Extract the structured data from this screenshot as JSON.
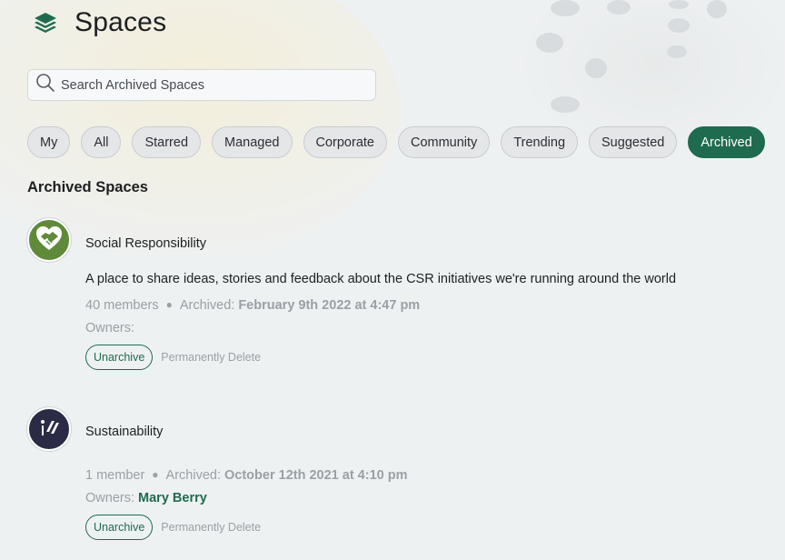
{
  "header": {
    "title": "Spaces",
    "icon": "layers-icon",
    "accent": "#1f6b4f"
  },
  "search": {
    "placeholder": "Search Archived Spaces",
    "value": ""
  },
  "filters": [
    {
      "label": "My",
      "active": false
    },
    {
      "label": "All",
      "active": false
    },
    {
      "label": "Starred",
      "active": false
    },
    {
      "label": "Managed",
      "active": false
    },
    {
      "label": "Corporate",
      "active": false
    },
    {
      "label": "Community",
      "active": false
    },
    {
      "label": "Trending",
      "active": false
    },
    {
      "label": "Suggested",
      "active": false
    },
    {
      "label": "Archived",
      "active": true
    }
  ],
  "section": {
    "title": "Archived Spaces"
  },
  "spaces": [
    {
      "name": "Social Responsibility",
      "avatar_icon": "heart-handshake-icon",
      "avatar_color": "#5f8a3a",
      "description": "A place to share ideas, stories and feedback about the CSR initiatives we're running around the world",
      "members": "40 members",
      "archived_label": "Archived:",
      "archived_date": "February 9th 2022 at 4:47 pm",
      "owners_label": "Owners:",
      "owners": "",
      "unarchive_label": "Unarchive",
      "delete_label": "Permanently Delete"
    },
    {
      "name": "Sustainability",
      "avatar_icon": "sustainability-logo-icon",
      "avatar_color": "#2b2b45",
      "description": "",
      "members": "1 member",
      "archived_label": "Archived:",
      "archived_date": "October 12th 2021 at 4:10 pm",
      "owners_label": "Owners:",
      "owners": "Mary Berry",
      "unarchive_label": "Unarchive",
      "delete_label": "Permanently Delete"
    }
  ]
}
